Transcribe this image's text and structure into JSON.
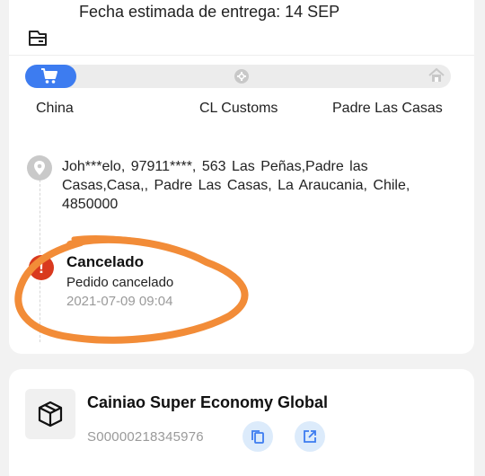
{
  "delivery": {
    "text": "Fecha estimada de entrega: 14 SEP",
    "icon": "delivery-truck-icon"
  },
  "progress": {
    "fraction_complete": 0.12,
    "stages": [
      {
        "label": "China",
        "icon": "cart-icon",
        "active": true
      },
      {
        "label": "CL Customs",
        "icon": "customs-icon",
        "active": false
      },
      {
        "label": "Padre Las Casas",
        "icon": "home-icon",
        "active": false
      }
    ]
  },
  "address": {
    "text": "Joh***elo, 97911****, 563 Las Peñas,Padre las Casas,Casa,, Padre Las Casas, La Araucania, Chile, 4850000",
    "icon": "location-pin-icon"
  },
  "status": {
    "title": "Cancelado",
    "description": "Pedido cancelado",
    "timestamp": "2021-07-09 09:04",
    "icon": "alert-icon"
  },
  "carrier": {
    "name": "Cainiao Super Economy Global",
    "tracking_number": "S00000218345976",
    "icon": "package-icon",
    "copy_icon": "copy-icon",
    "open_icon": "external-link-icon"
  },
  "colors": {
    "accent": "#3d7cf0",
    "alert": "#d9391e",
    "highlight": "#f28c38",
    "button_bg": "#dcebfb"
  }
}
